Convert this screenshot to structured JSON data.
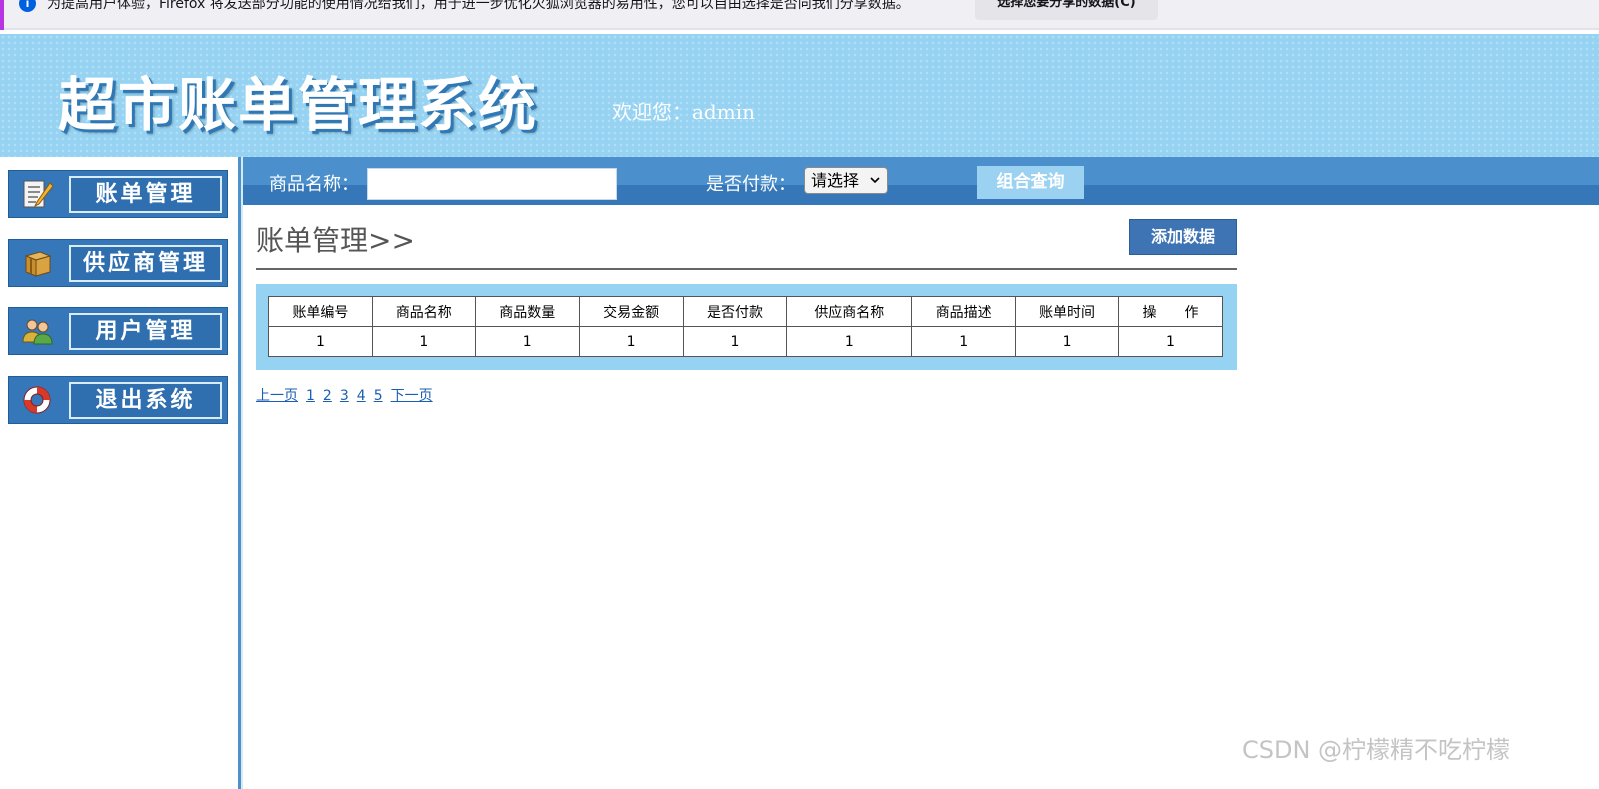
{
  "notification": {
    "message": "为提高用户体验，Firefox 将发送部分功能的使用情况给我们，用于进一步优化火狐浏览器的易用性，您可以自由选择是否向我们分享数据。",
    "button_label": "选择您要分享的数据(C)",
    "info_icon": "i"
  },
  "header": {
    "title": "超市账单管理系统",
    "welcome": "欢迎您：admin"
  },
  "sidebar": {
    "items": [
      {
        "label": "账单管理",
        "icon": "notepad-pencil-icon"
      },
      {
        "label": "供应商管理",
        "icon": "package-box-icon"
      },
      {
        "label": "用户管理",
        "icon": "users-icon"
      },
      {
        "label": "退出系统",
        "icon": "lifebuoy-icon"
      }
    ]
  },
  "search": {
    "product_label": "商品名称：",
    "product_value": "",
    "paid_label": "是否付款：",
    "paid_selected": "请选择",
    "query_button": "组合查询"
  },
  "main": {
    "title": "账单管理>>",
    "add_button": "添加数据",
    "table": {
      "headers": [
        "账单编号",
        "商品名称",
        "商品数量",
        "交易金额",
        "是否付款",
        "供应商名称",
        "商品描述",
        "账单时间",
        "操　　作"
      ],
      "rows": [
        [
          "1",
          "1",
          "1",
          "1",
          "1",
          "1",
          "1",
          "1",
          "1"
        ]
      ]
    }
  },
  "pagination": {
    "prev": "上一页",
    "pages": [
      "1",
      "2",
      "3",
      "4",
      "5"
    ],
    "next": "下一页"
  },
  "watermark": "CSDN @柠檬精不吃柠檬",
  "colors": {
    "header_bg": "#96d3f2",
    "nav_bg": "#3577b8",
    "search_bar_bg": "#4b90cc",
    "table_frame": "#96d3f2",
    "add_button_bg": "#3f74b4"
  }
}
